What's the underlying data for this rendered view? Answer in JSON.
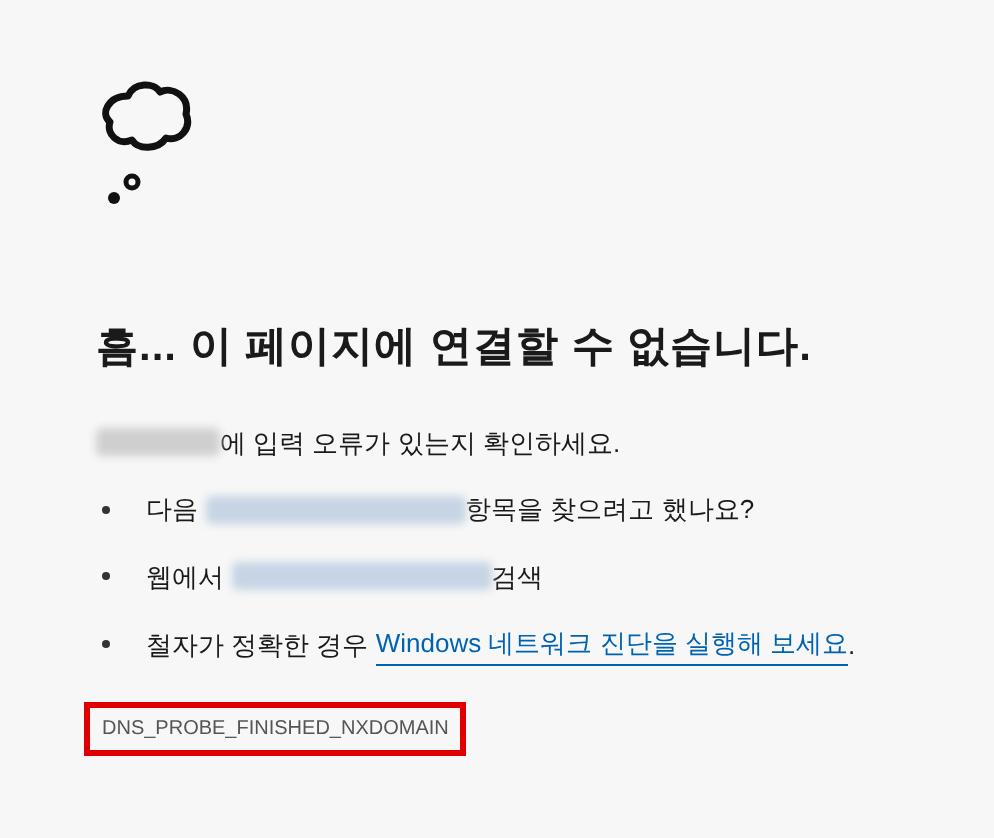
{
  "title": "흠... 이 페이지에 연결할 수 없습니다.",
  "intro": [
    {
      "kind": "blur_plain"
    },
    {
      "kind": "text",
      "text": "에 입력 오류가 있는지 확인하세요."
    }
  ],
  "suggestions": [
    [
      {
        "kind": "text",
        "text": "다음 "
      },
      {
        "kind": "blur_link"
      },
      {
        "kind": "text",
        "text": "항목을 찾으려고 했나요?"
      }
    ],
    [
      {
        "kind": "text",
        "text": "웹에서 "
      },
      {
        "kind": "blur_link"
      },
      {
        "kind": "text",
        "text": "검색"
      }
    ],
    [
      {
        "kind": "text",
        "text": "철자가 정확한 경우 "
      },
      {
        "kind": "link",
        "text": "Windows 네트워크 진단을 실행해 보세요"
      },
      {
        "kind": "text",
        "text": "."
      }
    ]
  ],
  "error_code": "DNS_PROBE_FINISHED_NXDOMAIN"
}
